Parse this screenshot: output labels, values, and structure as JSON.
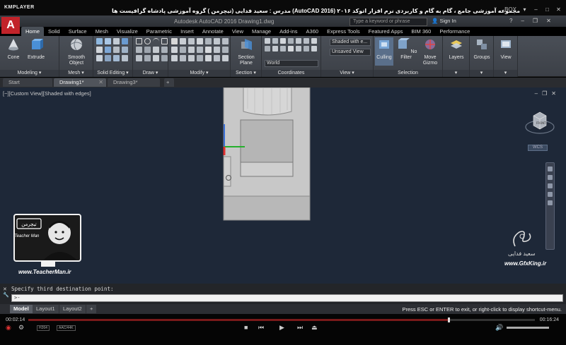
{
  "player": {
    "logo": "KMPLAYER",
    "title": "مجموعه آموزشی جامع ، گام به گام و کاربردی نرم افزار اتوکد ۲۰۱۶ (AutoCAD 2016)  مدرس : سعید فدایی (تیچرمن ) گروه آموزشی پادشاه گرافیست ها",
    "right_label": "BOX",
    "time_elapsed": "00:02:14",
    "time_total": "00:16:24",
    "progress": 0.83,
    "badges": [
      "H264",
      "AAC/44K"
    ]
  },
  "acad": {
    "logo": "A",
    "doc_title": "Autodesk AutoCAD 2016    Drawing1.dwg",
    "search_placeholder": "Type a keyword or phrase",
    "signin": "Sign In"
  },
  "ribbon_tabs": [
    "Home",
    "Solid",
    "Surface",
    "Mesh",
    "Visualize",
    "Parametric",
    "Insert",
    "Annotate",
    "View",
    "Manage",
    "Add-ins",
    "A360",
    "Express Tools",
    "Featured Apps",
    "BIM 360",
    "Performance"
  ],
  "ribbon": {
    "modeling": {
      "label": "Modeling",
      "cone": "Cone",
      "extrude": "Extrude",
      "smooth": "Smooth Object"
    },
    "mesh": {
      "label": "Mesh"
    },
    "solid_editing": {
      "label": "Solid Editing"
    },
    "draw": {
      "label": "Draw"
    },
    "modify": {
      "label": "Modify"
    },
    "section": {
      "label": "Section",
      "section_plane": "Section Plane"
    },
    "coordinates": {
      "label": "Coordinates",
      "ucs": "World"
    },
    "view": {
      "label": "View",
      "visual_style": "Shaded with e...",
      "saved_view": "Unsaved View"
    },
    "selection": {
      "label": "Selection",
      "culling": "Culling",
      "no_filter": "No Filter",
      "move_gizmo": "Move Gizmo"
    },
    "layers": {
      "label": "Layers"
    },
    "groups": {
      "label": "Groups"
    },
    "view_btn": {
      "label": "View"
    }
  },
  "doc_tabs": [
    {
      "label": "Start"
    },
    {
      "label": "Drawing1*"
    },
    {
      "label": "Drawing3*"
    }
  ],
  "viewport": {
    "label": "[−][Custom View][Shaded with edges]",
    "wcs": "WCS"
  },
  "teacher": {
    "card_title": "تیچرمن",
    "card_sub": "Teacher Man",
    "url": "www.TeacherMan.ir"
  },
  "author": {
    "name": "سعید فدایی",
    "site": "www.GfxKing.ir"
  },
  "command": {
    "history": "Specify third destination point:",
    "prompt": ">-"
  },
  "layout_tabs": [
    "Model",
    "Layout1",
    "Layout2"
  ],
  "status_msg": "Press ESC or ENTER to exit, or right-click to display shortcut-menu.",
  "colors": {
    "viewport_bg": "#1e2838",
    "accent": "#c2232a",
    "seek": "#7a1a1a"
  }
}
